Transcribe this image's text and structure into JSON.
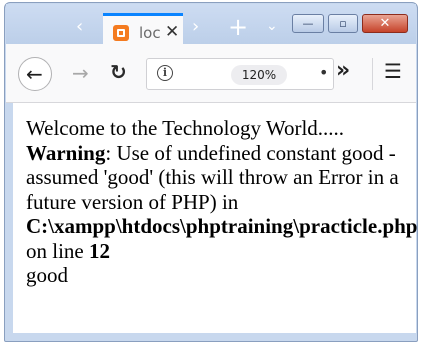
{
  "browser": {
    "tab_title": "loc",
    "tab_close": "✕",
    "nav_back_arrow": "‹",
    "nav_fwd_arrow": "›",
    "new_tab": "+",
    "tab_list": "⌄",
    "zoom": "120%",
    "info_glyph": "i",
    "url_more": "•",
    "overflow": "»",
    "menu": "☰",
    "back": "←",
    "forward": "→",
    "reload": "↻",
    "win_minimize": "—",
    "win_maximize": "▫",
    "win_close": "✕",
    "icons": {
      "favicon": "xampp-favicon-icon",
      "info": "info-icon",
      "back": "back-arrow-icon",
      "forward": "forward-arrow-icon",
      "reload": "reload-icon",
      "menu": "hamburger-menu-icon"
    },
    "colors": {
      "tab_accent": "#0a84ff",
      "favicon": "#f47b20",
      "close_button": "#c6432a"
    }
  },
  "page": {
    "line1": "Welcome to the Technology World.....",
    "warning_label": "Warning",
    "warning_text": ": Use of undefined constant good - assumed 'good' (this will throw an Error in a future version of PHP) in ",
    "file_path": "C:\\xampp\\htdocs\\phptraining\\practicle.php",
    "on_line_text": " on line ",
    "line_number": "12",
    "output": "good"
  }
}
